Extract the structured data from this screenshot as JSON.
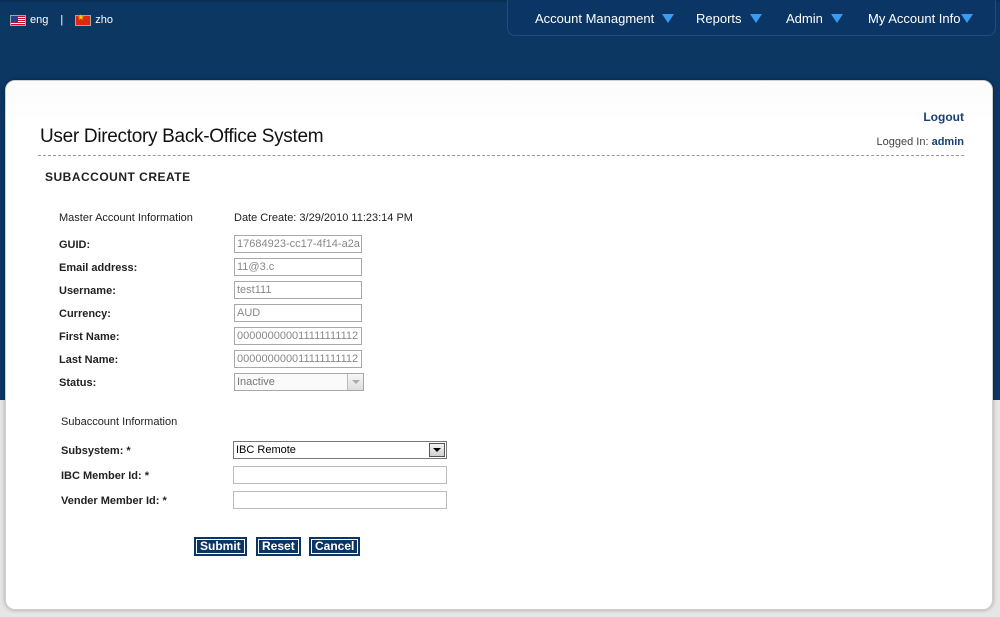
{
  "lang": {
    "eng": "eng",
    "sep": "|",
    "zho": "zho"
  },
  "nav": {
    "account_management": "Account Managment",
    "reports": "Reports",
    "admin": "Admin",
    "my_account_info": "My Account Info"
  },
  "header": {
    "title": "User Directory Back-Office System",
    "logout": "Logout",
    "logged_in_label": "Logged In:",
    "logged_in_user": "admin"
  },
  "section_title": "SUBACCOUNT CREATE",
  "master": {
    "heading": "Master Account Information",
    "date_create": "Date Create: 3/29/2010 11:23:14 PM",
    "fields": [
      {
        "label": "GUID:",
        "value": "17684923-cc17-4f14-a2a"
      },
      {
        "label": "Email address:",
        "value": "11@3.c"
      },
      {
        "label": "Username:",
        "value": "test111"
      },
      {
        "label": "Currency:",
        "value": "AUD"
      },
      {
        "label": "First Name:",
        "value": "000000000011111111112"
      },
      {
        "label": "Last Name:",
        "value": "000000000011111111112"
      }
    ],
    "status_label": "Status:",
    "status_value": "Inactive"
  },
  "subaccount": {
    "heading": "Subaccount Information",
    "subsystem_label": "Subsystem: *",
    "subsystem_value": "IBC Remote",
    "ibc_member_label": "IBC Member Id: *",
    "ibc_member_value": "",
    "vender_member_label": "Vender Member Id: *",
    "vender_member_value": ""
  },
  "buttons": {
    "submit": "Submit",
    "reset": "Reset",
    "cancel": "Cancel"
  },
  "colors": {
    "header_bg": "#0c3763",
    "button_bg": "#0b3564",
    "nav_arrow": "#3a9cf0",
    "link": "#1a3f72"
  }
}
